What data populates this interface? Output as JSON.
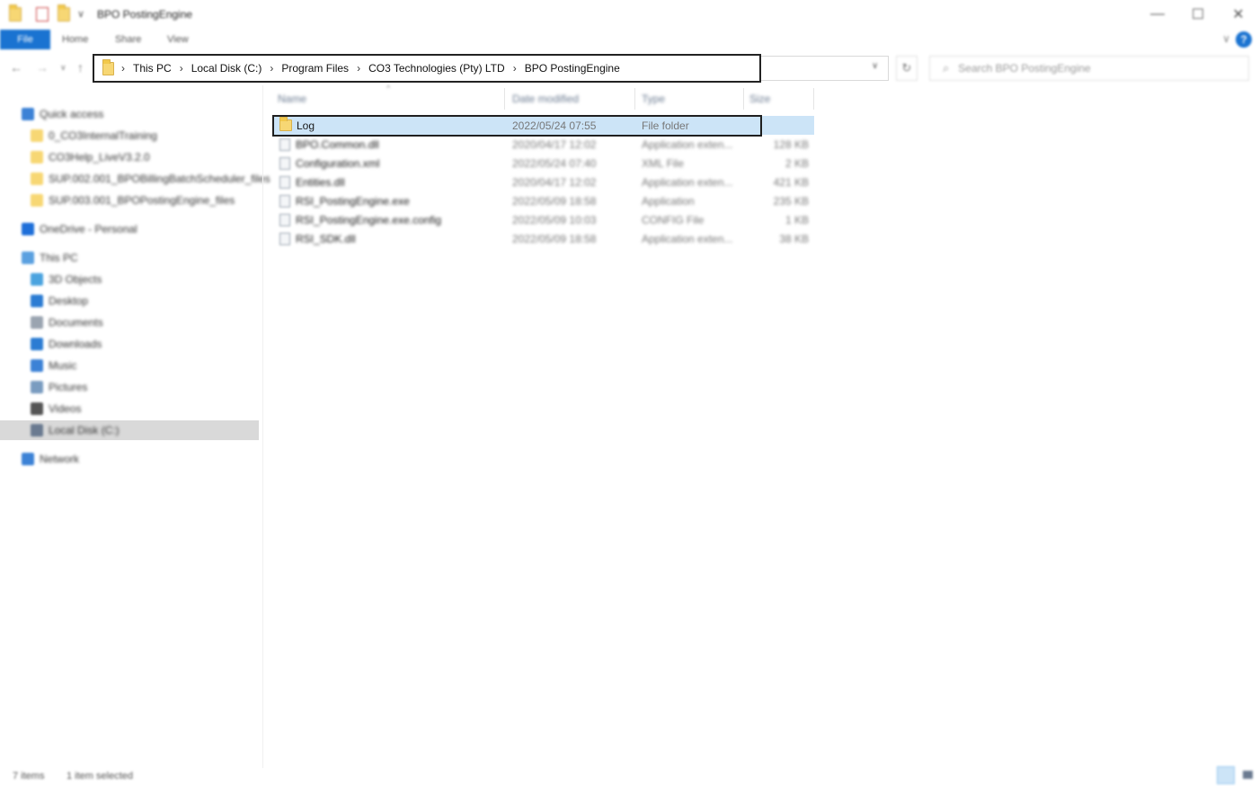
{
  "window": {
    "title": "BPO PostingEngine",
    "qat_dropdown": "∨",
    "controls": {
      "minimize": "—",
      "maximize": "☐",
      "close": "✕"
    }
  },
  "ribbon": {
    "tabs": [
      "File",
      "Home",
      "Share",
      "View"
    ],
    "expand_chevron": "∨",
    "help": "?"
  },
  "nav": {
    "back": "←",
    "forward": "→",
    "recent": "∨",
    "up": "↑",
    "breadcrumb": [
      "This PC",
      "Local Disk (C:)",
      "Program Files",
      "CO3 Technologies (Pty) LTD",
      "BPO PostingEngine"
    ],
    "separator": "›",
    "leading_separator": "›",
    "dropdown": "∨",
    "refresh": "↻",
    "search_placeholder": "Search BPO PostingEngine",
    "search_icon": "⌕"
  },
  "sidebar": {
    "items": [
      {
        "label": "Quick access",
        "icon": "pin-star-icon",
        "color": "#3c82d6"
      },
      {
        "label": "0_CO3InternalTraining",
        "icon": "folder-icon",
        "color": "#f7d774"
      },
      {
        "label": "CO3Help_LiveV3.2.0",
        "icon": "folder-icon",
        "color": "#f7d774"
      },
      {
        "label": "SUP.002.001_BPOBillingBatchScheduler_files",
        "icon": "folder-icon",
        "color": "#f7d774"
      },
      {
        "label": "SUP.003.001_BPOPostingEngine_files",
        "icon": "folder-icon",
        "color": "#f7d774"
      },
      {
        "label": "OneDrive - Personal",
        "icon": "cloud-icon",
        "color": "#1e6fd9"
      },
      {
        "label": "This PC",
        "icon": "computer-icon",
        "color": "#5aa0e0"
      },
      {
        "label": "3D Objects",
        "icon": "cube-icon",
        "color": "#4aa3df"
      },
      {
        "label": "Desktop",
        "icon": "desktop-icon",
        "color": "#2b7cd3"
      },
      {
        "label": "Documents",
        "icon": "document-icon",
        "color": "#9aa4b0"
      },
      {
        "label": "Downloads",
        "icon": "download-arrow-icon",
        "color": "#2b7cd3"
      },
      {
        "label": "Music",
        "icon": "music-note-icon",
        "color": "#3c82d6"
      },
      {
        "label": "Pictures",
        "icon": "picture-icon",
        "color": "#7a9cc0"
      },
      {
        "label": "Videos",
        "icon": "film-icon",
        "color": "#555555"
      },
      {
        "label": "Local Disk (C:)",
        "icon": "drive-icon",
        "color": "#6a7a90",
        "selected": true
      },
      {
        "label": "Network",
        "icon": "network-icon",
        "color": "#3c82d6"
      }
    ]
  },
  "filelist": {
    "columns": [
      "Name",
      "Date modified",
      "Type",
      "Size"
    ],
    "sort_caret": "^",
    "rows": [
      {
        "name": "Log",
        "date": "2022/05/24 07:55",
        "type": "File folder",
        "size": "",
        "icon": "folder-icon",
        "selected": true
      },
      {
        "name": "BPO.Common.dll",
        "date": "2020/04/17 12:02",
        "type": "Application exten...",
        "size": "128 KB",
        "icon": "dll-file-icon"
      },
      {
        "name": "Configuration.xml",
        "date": "2022/05/24 07:40",
        "type": "XML File",
        "size": "2 KB",
        "icon": "xml-file-icon"
      },
      {
        "name": "Entities.dll",
        "date": "2020/04/17 12:02",
        "type": "Application exten...",
        "size": "421 KB",
        "icon": "dll-file-icon"
      },
      {
        "name": "RSI_PostingEngine.exe",
        "date": "2022/05/09 18:58",
        "type": "Application",
        "size": "235 KB",
        "icon": "exe-file-icon"
      },
      {
        "name": "RSI_PostingEngine.exe.config",
        "date": "2022/05/09 10:03",
        "type": "CONFIG File",
        "size": "1 KB",
        "icon": "config-file-icon"
      },
      {
        "name": "RSI_SDK.dll",
        "date": "2022/05/09 18:58",
        "type": "Application exten...",
        "size": "38 KB",
        "icon": "dll-file-icon"
      }
    ]
  },
  "status": {
    "item_count": "7 items",
    "selection": "1 item selected"
  },
  "colors": {
    "accent": "#1a73d1",
    "selection": "#cce4f7",
    "folder": "#f7d774"
  }
}
